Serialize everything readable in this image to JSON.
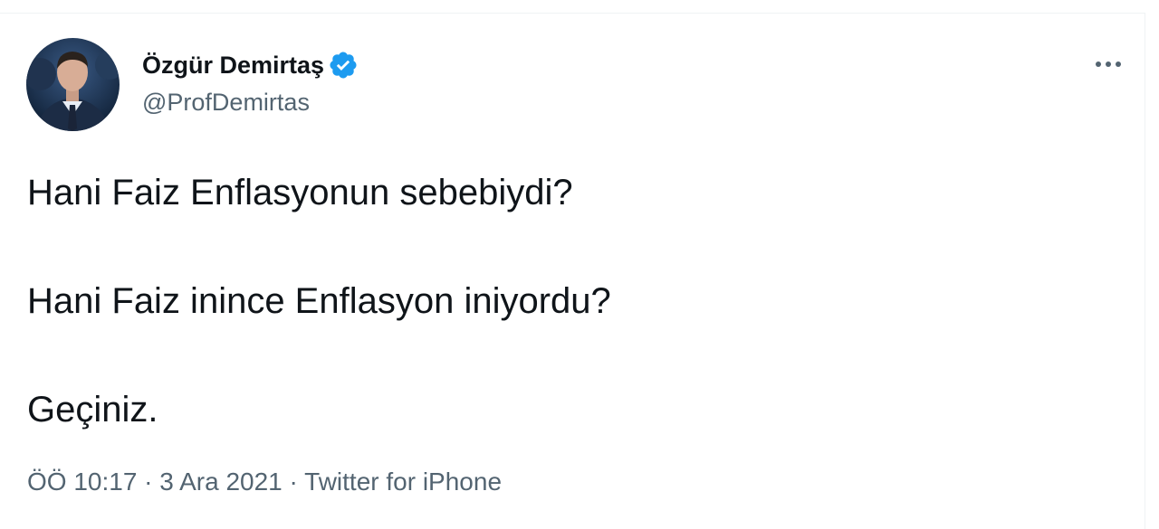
{
  "author": {
    "name": "Özgür Demirtaş",
    "handle": "@ProfDemirtas"
  },
  "tweet": {
    "lines": [
      "Hani Faiz Enflasyonun sebebiydi?",
      "Hani Faiz inince Enflasyon iniyordu?",
      "Geçiniz."
    ]
  },
  "meta": {
    "time": "ÖÖ 10:17",
    "separator1": " · ",
    "date": "3 Ara 2021",
    "separator2": " · ",
    "source": "Twitter for iPhone"
  },
  "icons": {
    "verified": "verified-badge-icon",
    "more": "more-options-icon"
  },
  "colors": {
    "verified_blue": "#1d9bf0",
    "text_primary": "#0f1419",
    "text_secondary": "#536471"
  }
}
